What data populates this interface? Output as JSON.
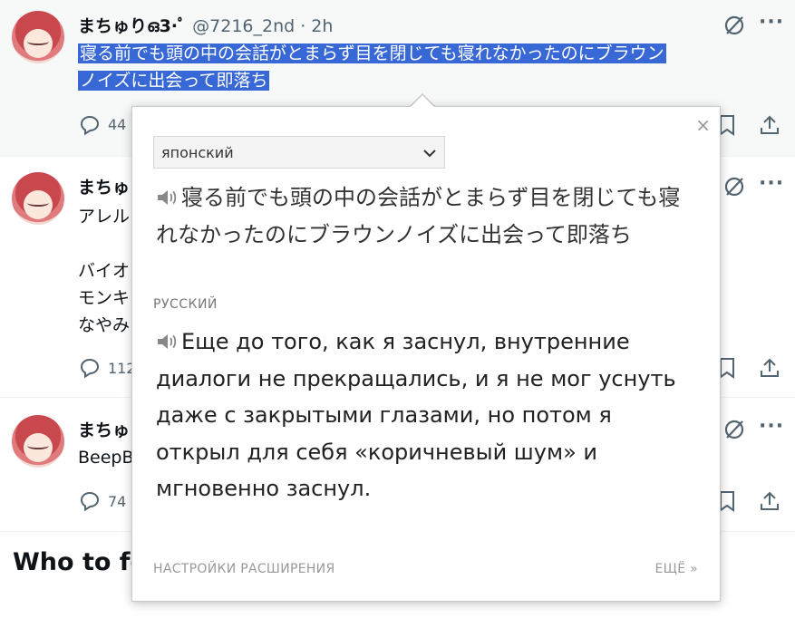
{
  "posts": [
    {
      "author": "まちゅりഒ3⋅ﾟ",
      "handle": "@7216_2nd · 2h",
      "text_line1": "寝る前でも頭の中の会話がとまらず目を閉じても寝れなかったのにブラウン",
      "text_line2": "ノイズに出会って即落ち",
      "reply_count": "44"
    },
    {
      "author": "まちゅ",
      "line1": "アレル",
      "line2": "バイオ",
      "line3": "モンキ",
      "line4": "なやみ",
      "reply_count": "112"
    },
    {
      "author": "まちゅ",
      "line1": "BeepB",
      "reply_count": "74"
    }
  ],
  "who_to_follow": "Who to fo",
  "translator": {
    "source_language": "японский",
    "source_text": "寝る前でも頭の中の会話がとまらず目を閉じても寝れなかったのにブラウンノイズに出会って即落ち",
    "target_language": "РУССКИЙ",
    "target_text": "Еще до того, как я заснул, внутренние диалоги не прекращались, и я не мог уснуть даже с закрытыми глазами, но потом я открыл для себя «коричневый шум» и мгновенно заснул.",
    "settings_link": "НАСТРОЙКИ РАСШИРЕНИЯ",
    "more_link": "ЕЩЁ »",
    "close_symbol": "×"
  },
  "icons": {
    "reply": "reply-icon",
    "bookmark": "bookmark-icon",
    "share": "share-icon",
    "grok": "grok-icon",
    "more": "more-icon",
    "speaker": "speaker-icon"
  }
}
